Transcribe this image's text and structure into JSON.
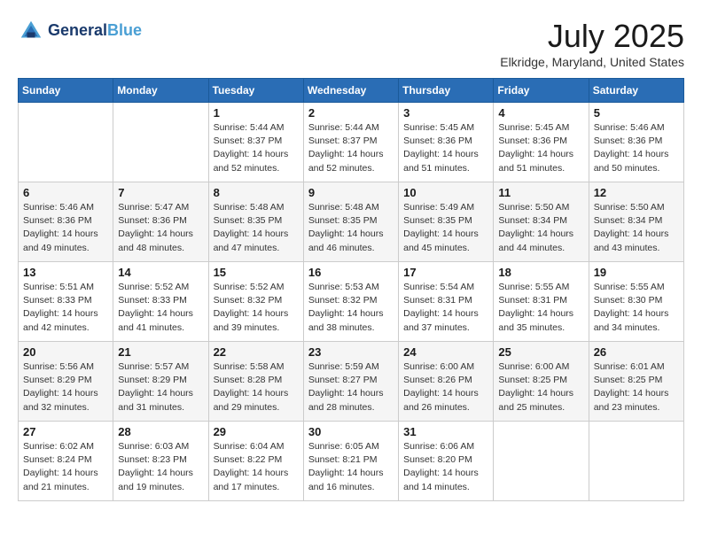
{
  "header": {
    "logo_line1": "General",
    "logo_line2": "Blue",
    "month_year": "July 2025",
    "location": "Elkridge, Maryland, United States"
  },
  "days_of_week": [
    "Sunday",
    "Monday",
    "Tuesday",
    "Wednesday",
    "Thursday",
    "Friday",
    "Saturday"
  ],
  "weeks": [
    [
      {
        "day": "",
        "info": ""
      },
      {
        "day": "",
        "info": ""
      },
      {
        "day": "1",
        "info": "Sunrise: 5:44 AM\nSunset: 8:37 PM\nDaylight: 14 hours and 52 minutes."
      },
      {
        "day": "2",
        "info": "Sunrise: 5:44 AM\nSunset: 8:37 PM\nDaylight: 14 hours and 52 minutes."
      },
      {
        "day": "3",
        "info": "Sunrise: 5:45 AM\nSunset: 8:36 PM\nDaylight: 14 hours and 51 minutes."
      },
      {
        "day": "4",
        "info": "Sunrise: 5:45 AM\nSunset: 8:36 PM\nDaylight: 14 hours and 51 minutes."
      },
      {
        "day": "5",
        "info": "Sunrise: 5:46 AM\nSunset: 8:36 PM\nDaylight: 14 hours and 50 minutes."
      }
    ],
    [
      {
        "day": "6",
        "info": "Sunrise: 5:46 AM\nSunset: 8:36 PM\nDaylight: 14 hours and 49 minutes."
      },
      {
        "day": "7",
        "info": "Sunrise: 5:47 AM\nSunset: 8:36 PM\nDaylight: 14 hours and 48 minutes."
      },
      {
        "day": "8",
        "info": "Sunrise: 5:48 AM\nSunset: 8:35 PM\nDaylight: 14 hours and 47 minutes."
      },
      {
        "day": "9",
        "info": "Sunrise: 5:48 AM\nSunset: 8:35 PM\nDaylight: 14 hours and 46 minutes."
      },
      {
        "day": "10",
        "info": "Sunrise: 5:49 AM\nSunset: 8:35 PM\nDaylight: 14 hours and 45 minutes."
      },
      {
        "day": "11",
        "info": "Sunrise: 5:50 AM\nSunset: 8:34 PM\nDaylight: 14 hours and 44 minutes."
      },
      {
        "day": "12",
        "info": "Sunrise: 5:50 AM\nSunset: 8:34 PM\nDaylight: 14 hours and 43 minutes."
      }
    ],
    [
      {
        "day": "13",
        "info": "Sunrise: 5:51 AM\nSunset: 8:33 PM\nDaylight: 14 hours and 42 minutes."
      },
      {
        "day": "14",
        "info": "Sunrise: 5:52 AM\nSunset: 8:33 PM\nDaylight: 14 hours and 41 minutes."
      },
      {
        "day": "15",
        "info": "Sunrise: 5:52 AM\nSunset: 8:32 PM\nDaylight: 14 hours and 39 minutes."
      },
      {
        "day": "16",
        "info": "Sunrise: 5:53 AM\nSunset: 8:32 PM\nDaylight: 14 hours and 38 minutes."
      },
      {
        "day": "17",
        "info": "Sunrise: 5:54 AM\nSunset: 8:31 PM\nDaylight: 14 hours and 37 minutes."
      },
      {
        "day": "18",
        "info": "Sunrise: 5:55 AM\nSunset: 8:31 PM\nDaylight: 14 hours and 35 minutes."
      },
      {
        "day": "19",
        "info": "Sunrise: 5:55 AM\nSunset: 8:30 PM\nDaylight: 14 hours and 34 minutes."
      }
    ],
    [
      {
        "day": "20",
        "info": "Sunrise: 5:56 AM\nSunset: 8:29 PM\nDaylight: 14 hours and 32 minutes."
      },
      {
        "day": "21",
        "info": "Sunrise: 5:57 AM\nSunset: 8:29 PM\nDaylight: 14 hours and 31 minutes."
      },
      {
        "day": "22",
        "info": "Sunrise: 5:58 AM\nSunset: 8:28 PM\nDaylight: 14 hours and 29 minutes."
      },
      {
        "day": "23",
        "info": "Sunrise: 5:59 AM\nSunset: 8:27 PM\nDaylight: 14 hours and 28 minutes."
      },
      {
        "day": "24",
        "info": "Sunrise: 6:00 AM\nSunset: 8:26 PM\nDaylight: 14 hours and 26 minutes."
      },
      {
        "day": "25",
        "info": "Sunrise: 6:00 AM\nSunset: 8:25 PM\nDaylight: 14 hours and 25 minutes."
      },
      {
        "day": "26",
        "info": "Sunrise: 6:01 AM\nSunset: 8:25 PM\nDaylight: 14 hours and 23 minutes."
      }
    ],
    [
      {
        "day": "27",
        "info": "Sunrise: 6:02 AM\nSunset: 8:24 PM\nDaylight: 14 hours and 21 minutes."
      },
      {
        "day": "28",
        "info": "Sunrise: 6:03 AM\nSunset: 8:23 PM\nDaylight: 14 hours and 19 minutes."
      },
      {
        "day": "29",
        "info": "Sunrise: 6:04 AM\nSunset: 8:22 PM\nDaylight: 14 hours and 17 minutes."
      },
      {
        "day": "30",
        "info": "Sunrise: 6:05 AM\nSunset: 8:21 PM\nDaylight: 14 hours and 16 minutes."
      },
      {
        "day": "31",
        "info": "Sunrise: 6:06 AM\nSunset: 8:20 PM\nDaylight: 14 hours and 14 minutes."
      },
      {
        "day": "",
        "info": ""
      },
      {
        "day": "",
        "info": ""
      }
    ]
  ]
}
